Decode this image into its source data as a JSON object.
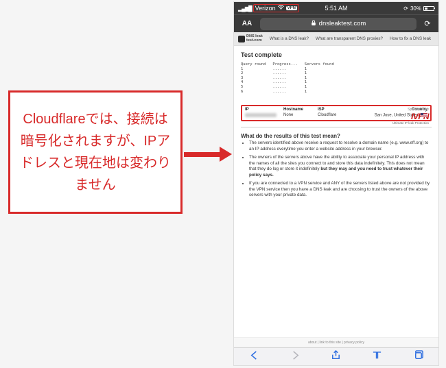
{
  "annotation": {
    "text": "Cloudflareでは、接続は暗号化されますが、IPアドレスと現在地は変わりません"
  },
  "statusbar": {
    "carrier": "Verizon",
    "vpn_label": "VPN",
    "time": "5:51 AM",
    "battery_pct": "30%"
  },
  "urlbar": {
    "aa": "AA",
    "lock_icon": "lock-icon",
    "domain": "dnsleaktest.com"
  },
  "page_nav": {
    "logo_line1": "DNS leak",
    "logo_line2": "test.com",
    "link1": "What is a DNS leak?",
    "link2": "What are transparent DNS proxies?",
    "link3": "How to fix a DNS leak"
  },
  "test": {
    "heading": "Test complete",
    "tbl_header": "Query round   Progress...   Servers found",
    "rows": [
      "1             ......        1",
      "2             ......        1",
      "3             ......        1",
      "4             ......        1",
      "5             ......        1",
      "6             ......        1"
    ]
  },
  "sponsor": {
    "label": "Sponsored by",
    "brand": "IVPN",
    "tagline": "Ultimate IP leak Protection"
  },
  "ipresult": {
    "h_ip": "IP",
    "h_host": "Hostname",
    "h_isp": "ISP",
    "h_country": "Country",
    "host": "None",
    "isp": "Cloudflare",
    "country": "San Jose, United States"
  },
  "results": {
    "heading": "What do the results of this test mean?",
    "b1": "The servers identified above receive a request to resolve a domain name (e.g. www.eff.org) to an IP address everytime you enter a website address in your browser.",
    "b2a": "The owners of the servers above have the ability to associate your personal IP address with the names of all the sites you connect to and store this data indefinitely. This does not mean that they do log or store it indefinitely ",
    "b2b": "but they may and you need to trust whatever their policy says.",
    "b3": "If you are connected to a VPN service and ANY of the servers listed above are not provided by the VPN service then you have a DNS leak and are choosing to trust the owners of the above servers with your private data."
  },
  "footer": "about | link to this site | privacy policy"
}
